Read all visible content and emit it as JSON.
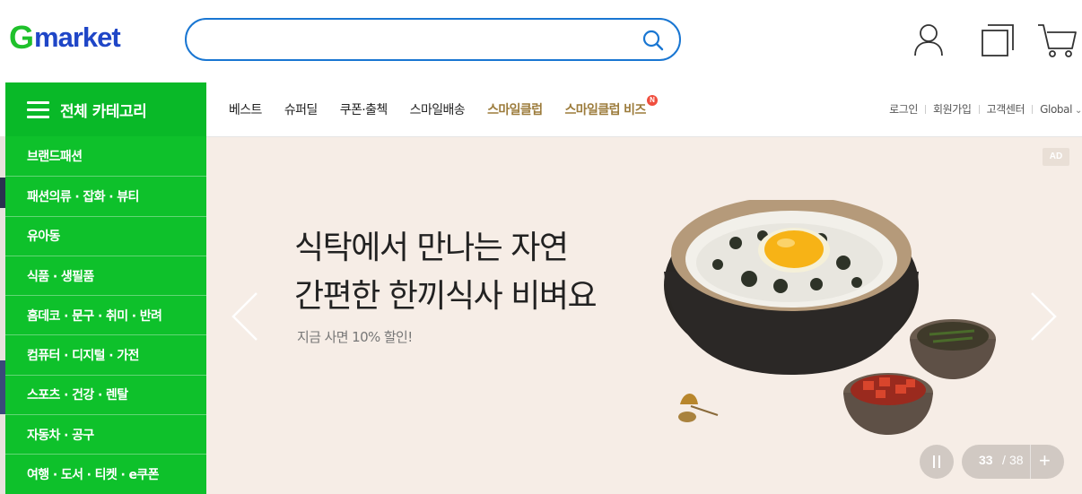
{
  "header": {
    "logo_g": "G",
    "logo_rest": "market",
    "search_placeholder": "",
    "search_value": ""
  },
  "icons": {
    "search": "search-icon",
    "user": "user-icon",
    "recent": "recent-items-icon",
    "cart": "cart-icon"
  },
  "colors": {
    "brand_green": "#0ec12b",
    "logo_blue": "#1f46c7",
    "search_border": "#1976d2",
    "club_gold": "#9c7c3c",
    "banner_bg": "#f6ede6"
  },
  "sidebar": {
    "title": "전체 카테고리",
    "items": [
      "브랜드패션",
      "패션의류 · 잡화 · 뷰티",
      "유아동",
      "식품 · 생필품",
      "홈데코 · 문구 · 취미 · 반려",
      "컴퓨터 · 디지털 · 가전",
      "스포츠 · 건강 · 렌탈",
      "자동차 · 공구",
      "여행 · 도서 · 티켓 · e쿠폰"
    ]
  },
  "gnb": {
    "menu": [
      "베스트",
      "슈퍼딜",
      "쿠폰·출첵",
      "스마일배송",
      "스마일클럽",
      "스마일클럽 비즈"
    ],
    "new_badge": "N",
    "util": [
      "로그인",
      "회원가입",
      "고객센터",
      "Global"
    ]
  },
  "banner": {
    "ad_label": "AD",
    "line1": "식탁에서 만나는 자연",
    "line2": "간편한 한끼식사 비벼요",
    "sub": "지금 사면 10% 할인!",
    "current": "33",
    "slash": "/",
    "total": "38",
    "more": "+"
  }
}
